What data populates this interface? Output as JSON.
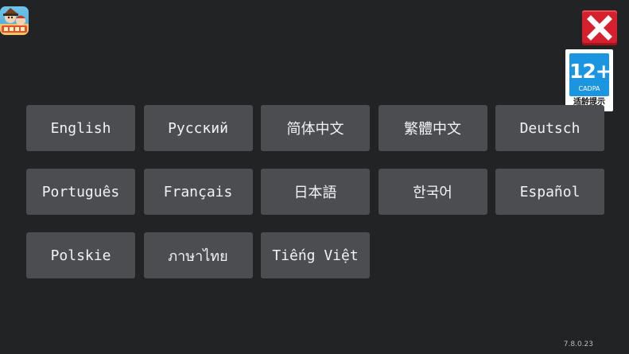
{
  "app_icon": "game-app-icon",
  "close_icon": "close-x-icon",
  "age_rating": {
    "number": "12+",
    "org": "CADPA",
    "caption": "适龄提示"
  },
  "languages": [
    "English",
    "Русский",
    "简体中文",
    "繁體中文",
    "Deutsch",
    "Português",
    "Français",
    "日本語",
    "한국어",
    "Español",
    "Polskie",
    "ภาษาไทย",
    "Tiếng Việt"
  ],
  "version": "7.8.0.23",
  "colors": {
    "background": "#222325",
    "button": "#4c4d50",
    "close": "#d6202d",
    "age_badge": "#1b95e0"
  }
}
